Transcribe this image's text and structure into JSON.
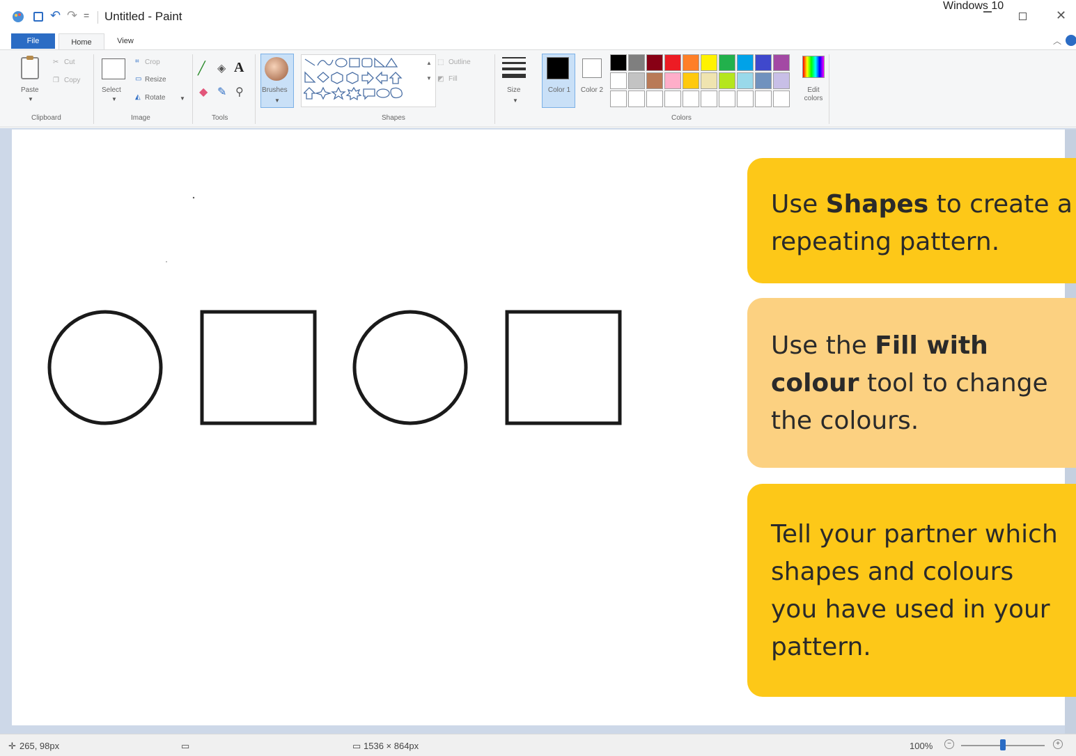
{
  "window": {
    "title": "Untitled - Paint",
    "os_label": "Windows 10",
    "controls": {
      "minimize": "–",
      "maximize": "☐",
      "close": "✕"
    }
  },
  "quick_access": {
    "undo": "↶",
    "redo": "↷",
    "customize": "="
  },
  "tabs": [
    {
      "label": "File",
      "active": false
    },
    {
      "label": "Home",
      "active": true
    },
    {
      "label": "View",
      "active": false
    }
  ],
  "ribbon": {
    "clipboard": {
      "paste": "Paste",
      "cut": "Cut",
      "copy": "Copy",
      "group": "Clipboard"
    },
    "image": {
      "select": "Select",
      "crop": "Crop",
      "resize": "Resize",
      "rotate": "Rotate",
      "group": "Image"
    },
    "tools": {
      "group": "Tools"
    },
    "brushes": {
      "label": "Brushes"
    },
    "shapes": {
      "outline": "Outline",
      "fill": "Fill",
      "group": "Shapes"
    },
    "size": {
      "label": "Size"
    },
    "colors": {
      "color1": "Color 1",
      "color2": "Color 2",
      "edit": "Edit colors",
      "group": "Colors",
      "palette": [
        "#000000",
        "#7f7f7f",
        "#880015",
        "#ed1c24",
        "#ff7f27",
        "#fff200",
        "#22b14c",
        "#00a2e8",
        "#3f48cc",
        "#a349a4",
        "#ffffff",
        "#c3c3c3",
        "#b97a57",
        "#ffaec9",
        "#ffc90e",
        "#efe4b0",
        "#b5e61d",
        "#99d9ea",
        "#7092be",
        "#c8bfe7",
        "#ffffff",
        "#ffffff",
        "#ffffff",
        "#ffffff",
        "#ffffff",
        "#ffffff",
        "#ffffff",
        "#ffffff",
        "#ffffff",
        "#ffffff"
      ]
    }
  },
  "canvas": {
    "shapes": [
      "circle",
      "square",
      "circle",
      "square"
    ]
  },
  "notes": [
    {
      "pre": "Use ",
      "bold": "Shapes",
      "post": " to create a",
      "line2": "repeating pattern.",
      "color": "#fdc818"
    },
    {
      "pre": "Use the ",
      "bold": "Fill with",
      "bold2": "colour",
      "post": " tool to change",
      "line3": "the colours.",
      "color": "#fcd181"
    },
    {
      "line1": "Tell your partner which",
      "line2": "shapes and colours",
      "line3": "you have used in your",
      "line4": "pattern.",
      "color": "#fdc818"
    }
  ],
  "statusbar": {
    "cursor": "265, 98px",
    "size": "1536 × 864px",
    "zoom": "100%"
  }
}
